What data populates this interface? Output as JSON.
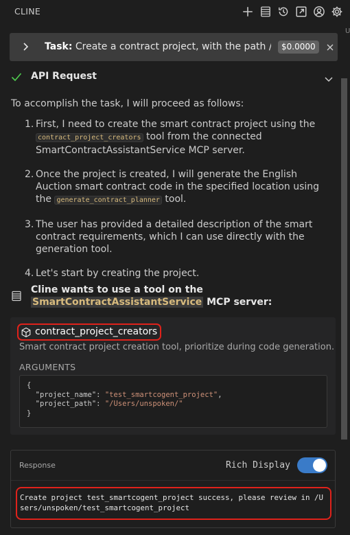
{
  "app": {
    "title": "CLINE"
  },
  "toolbar": {
    "icons": [
      "plus-icon",
      "history-list-icon",
      "history-icon",
      "popout-icon",
      "account-icon",
      "gear-icon"
    ]
  },
  "edge_fragment": "U",
  "task": {
    "label": "Task:",
    "text": "Create a contract project, with the path /...",
    "cost": "$0.0000"
  },
  "api_request": {
    "label": "API Request"
  },
  "message": {
    "intro": "To accomplish the task, I will proceed as follows:",
    "steps": [
      {
        "num": "1.",
        "pre": "First, I need to create the smart contract project using the ",
        "code": "contract_project_creators",
        "post": " tool from the connected SmartContractAssistantService MCP server."
      },
      {
        "num": "2.",
        "pre": "Once the project is created, I will generate the English Auction smart contract code in the specified location using the ",
        "code": "generate_contract_planner",
        "post": " tool."
      },
      {
        "num": "3.",
        "pre": "The user has provided a detailed description of the smart contract requirements, which I can use directly with the generation tool.",
        "code": "",
        "post": ""
      },
      {
        "num": "4.",
        "pre": "Let's start by creating the project.",
        "code": "",
        "post": ""
      }
    ]
  },
  "tool_request": {
    "prefix": "Cline wants to use a tool on the ",
    "server": "SmartContractAssistantService",
    "suffix": " MCP server:"
  },
  "tool": {
    "name": "contract_project_creators",
    "description": "Smart contract project creation tool, prioritize during code generation.",
    "arguments_label": "ARGUMENTS",
    "arguments": {
      "open": "{",
      "k1": "\"project_name\"",
      "v1": "\"test_smartcogent_project\"",
      "k2": "\"project_path\"",
      "v2": "\"/Users/unspoken/\"",
      "close": "}"
    }
  },
  "response": {
    "label": "Response",
    "rich_display_label": "Rich Display",
    "rich_display_on": true,
    "text": "Create project test_smartcogent_project success, please review in /Users/unspoken/test_smartcogent_project"
  },
  "colors": {
    "accent": "#3a7bc8",
    "highlight_border": "#e0221b",
    "success": "#4ec94e",
    "code": "#d7ba7d"
  }
}
